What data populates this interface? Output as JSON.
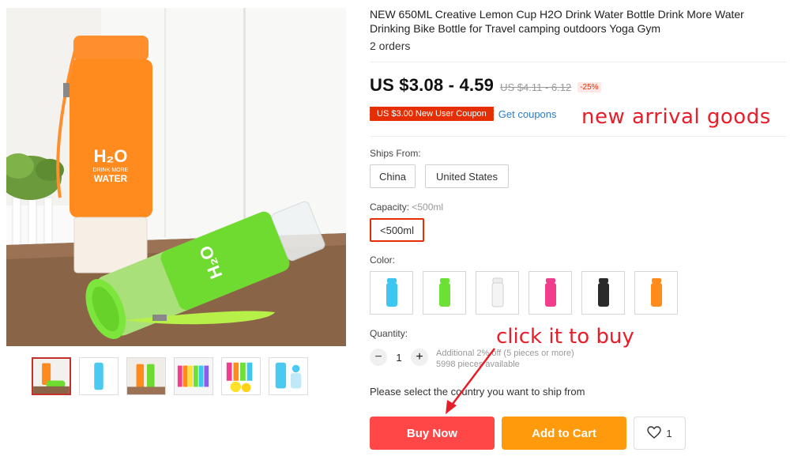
{
  "product": {
    "title": "NEW 650ML Creative Lemon Cup H2O Drink Water Bottle Drink More Water Drinking Bike Bottle for Travel camping outdoors Yoga Gym",
    "orders": "2 orders",
    "price": "US $3.08 - 4.59",
    "old_price": "US $4.11 - 6.12",
    "discount": "-25%",
    "coupon_label": "US $3.00 New User Coupon",
    "get_coupons_label": "Get coupons",
    "bottle_text_line1": "H₂O",
    "bottle_text_line2": "DRINK MORE",
    "bottle_text_line3": "WATER"
  },
  "annotations": {
    "new_arrival": "new arrival goods",
    "click_to_buy": "click it to buy"
  },
  "ships_from": {
    "label": "Ships From:",
    "options": [
      "China",
      "United States"
    ]
  },
  "capacity": {
    "label": "Capacity:",
    "selected": "<500ml",
    "options": [
      "<500ml"
    ]
  },
  "color": {
    "label": "Color:",
    "swatches": [
      "sky-blue",
      "green",
      "white",
      "pink",
      "black",
      "orange"
    ],
    "swatch_colors": [
      "#3cc6f0",
      "#6be035",
      "#f2f2f2",
      "#f03e8c",
      "#2a2a2a",
      "#ff8c1a"
    ]
  },
  "quantity": {
    "label": "Quantity:",
    "value": "1",
    "minus": "−",
    "plus": "+",
    "discount_note": "Additional 2% off (5 pieces or more)",
    "available": "5998 pieces available"
  },
  "ship_note": "Please select the country you want to ship from",
  "actions": {
    "buy_now": "Buy Now",
    "add_to_cart": "Add to Cart",
    "wishlist_count": "1"
  },
  "thumbnails": [
    "orange-green-bottles",
    "blue-bottle",
    "orange-green-pair",
    "rainbow-bottles",
    "colored-bottles-lemons",
    "blue-bottle-parts"
  ],
  "colors": {
    "accent_red": "#ff4747",
    "accent_orange": "#ff9a0d",
    "coupon_red": "#e62e04",
    "link_blue": "#2d7cc9",
    "annotation_red": "#e81d2a"
  }
}
